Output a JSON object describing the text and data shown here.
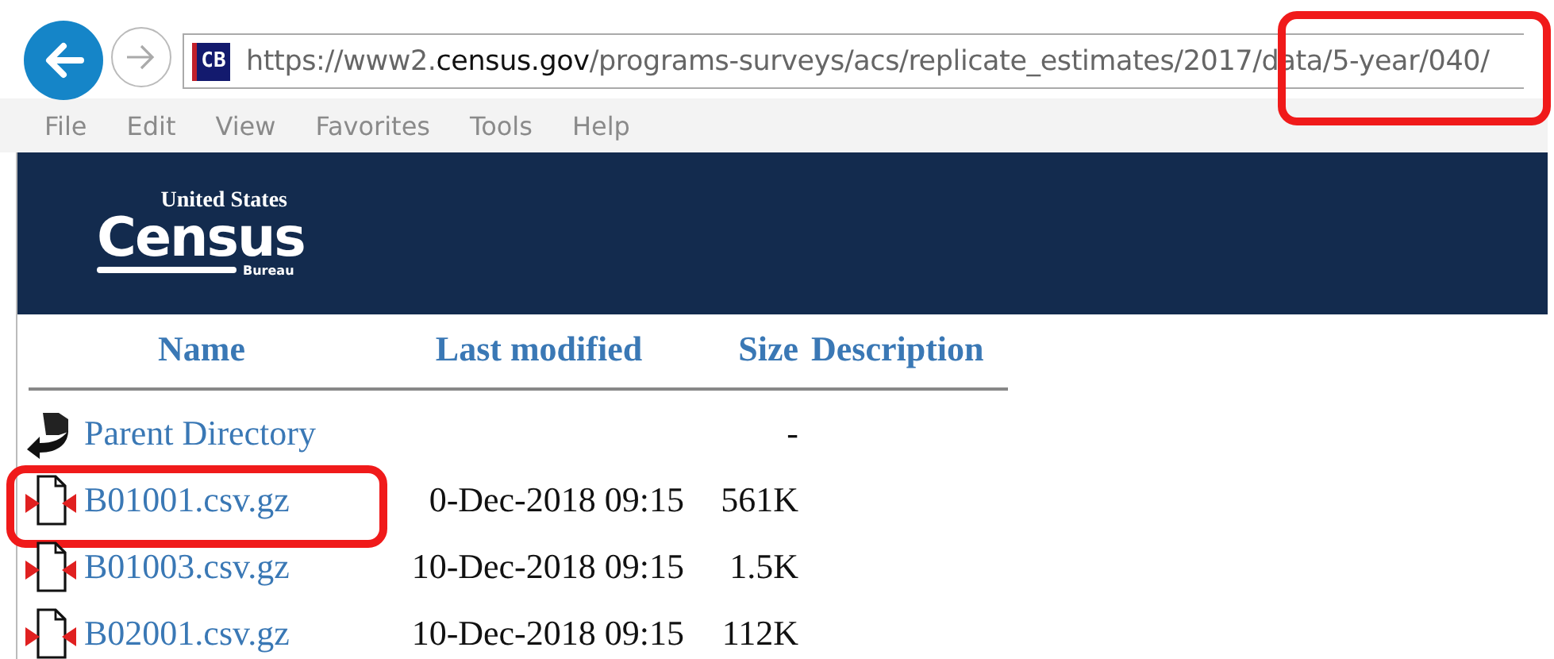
{
  "browser": {
    "address_bar": {
      "favicon_text": "CB",
      "highlighted": true,
      "url_parts": [
        {
          "text": "https://www2.",
          "emphasis": false
        },
        {
          "text": "census.gov",
          "emphasis": true
        },
        {
          "text": "/programs-surveys/acs/replicate_estimates/2017/data/5-year/040/",
          "emphasis": false
        }
      ]
    },
    "menu": [
      "File",
      "Edit",
      "View",
      "Favorites",
      "Tools",
      "Help"
    ]
  },
  "banner": {
    "logo": {
      "top": "United States",
      "main": "Census",
      "sub": "Bureau"
    }
  },
  "listing": {
    "columns": [
      "Name",
      "Last modified",
      "Size",
      "Description"
    ],
    "rows": [
      {
        "kind": "parent",
        "name": "Parent Directory",
        "modified": "",
        "size": "-",
        "highlighted": false
      },
      {
        "kind": "file",
        "name": "B01001.csv.gz",
        "modified": "0-Dec-2018 09:15",
        "size": "561K",
        "highlighted": true
      },
      {
        "kind": "file",
        "name": "B01003.csv.gz",
        "modified": "10-Dec-2018 09:15",
        "size": "1.5K",
        "highlighted": false
      },
      {
        "kind": "file",
        "name": "B02001.csv.gz",
        "modified": "10-Dec-2018 09:15",
        "size": "112K",
        "highlighted": false
      }
    ]
  }
}
